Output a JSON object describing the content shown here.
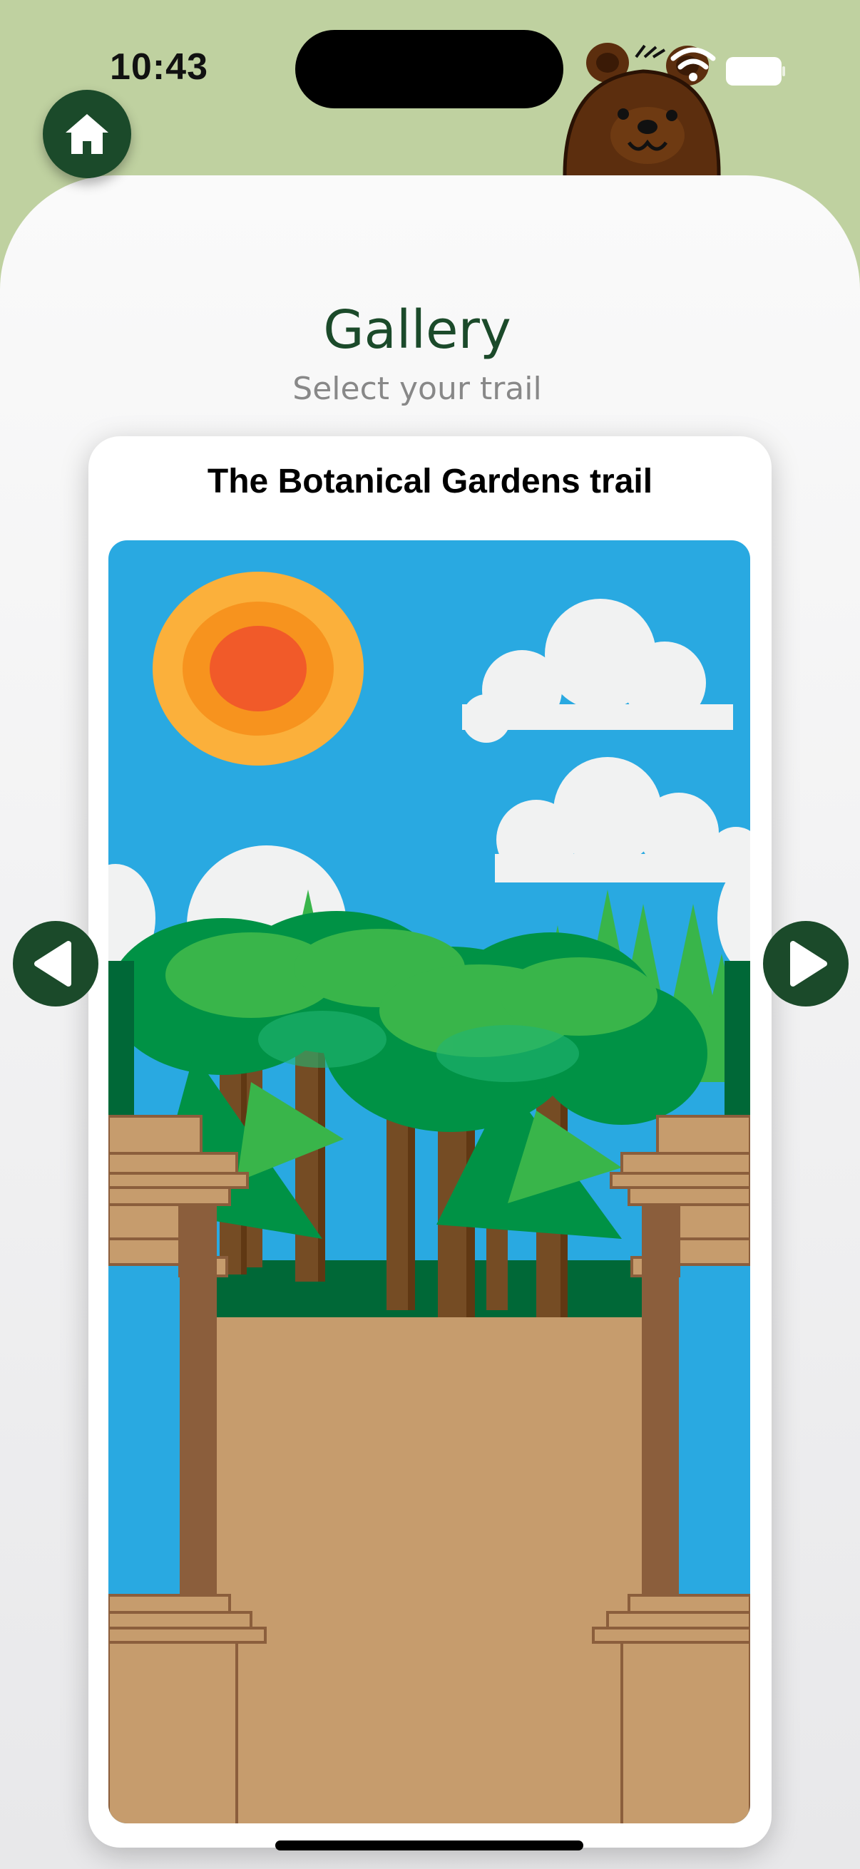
{
  "status_bar": {
    "time": "10:43",
    "wifi_icon": "wifi-icon",
    "battery_icon": "battery-icon"
  },
  "header": {
    "title": "Gallery",
    "subtitle": "Select your trail",
    "home_icon": "home-icon"
  },
  "carousel": {
    "current_trail": "The Botanical Gardens trail",
    "prev_icon": "chevron-left-icon",
    "next_icon": "chevron-right-icon"
  },
  "colors": {
    "accent": "#1b4a2a",
    "background": "#bfd1a0",
    "sky": "#29a9e1"
  }
}
